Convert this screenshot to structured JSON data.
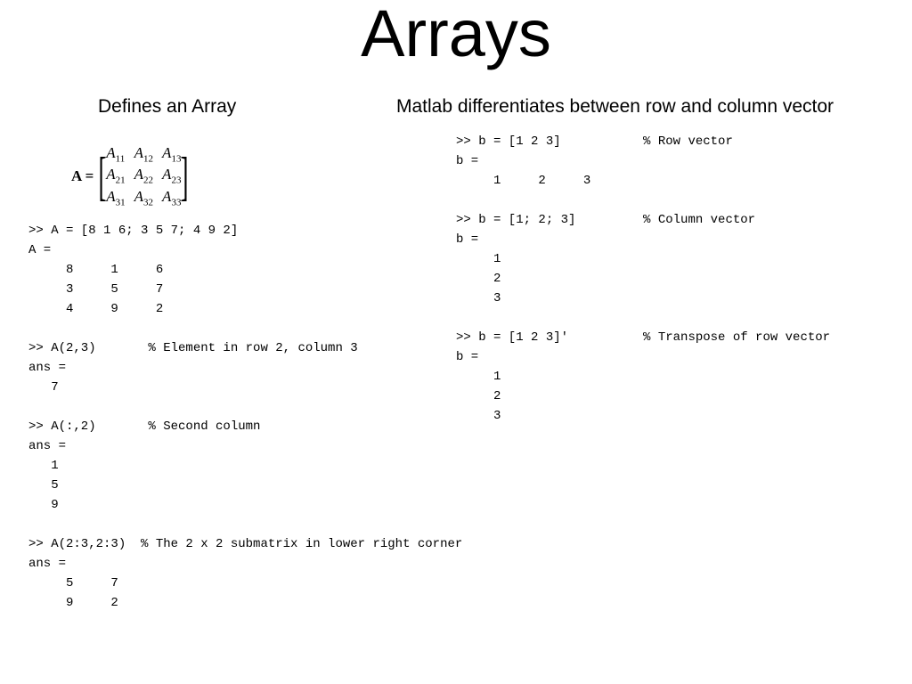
{
  "title": "Arrays",
  "sub_left": "Defines an Array",
  "sub_right": "Matlab differentiates between row and column vector",
  "matrix": {
    "label": "A =",
    "cells": [
      "A",
      "A",
      "A",
      "A",
      "A",
      "A",
      "A",
      "A",
      "A"
    ],
    "subs": [
      "11",
      "12",
      "13",
      "21",
      "22",
      "23",
      "31",
      "32",
      "33"
    ]
  },
  "code_left": ">> A = [8 1 6; 3 5 7; 4 9 2]\nA =\n     8     1     6\n     3     5     7\n     4     9     2\n\n>> A(2,3)       % Element in row 2, column 3\nans =\n   7\n\n>> A(:,2)       % Second column\nans =\n   1\n   5\n   9\n\n>> A(2:3,2:3)  % The 2 x 2 submatrix in lower right corner\nans =\n     5     7\n     9     2",
  "code_right": ">> b = [1 2 3]           % Row vector\nb =\n     1     2     3\n\n>> b = [1; 2; 3]         % Column vector\nb =\n     1\n     2\n     3\n\n>> b = [1 2 3]'          % Transpose of row vector\nb =\n     1\n     2\n     3"
}
